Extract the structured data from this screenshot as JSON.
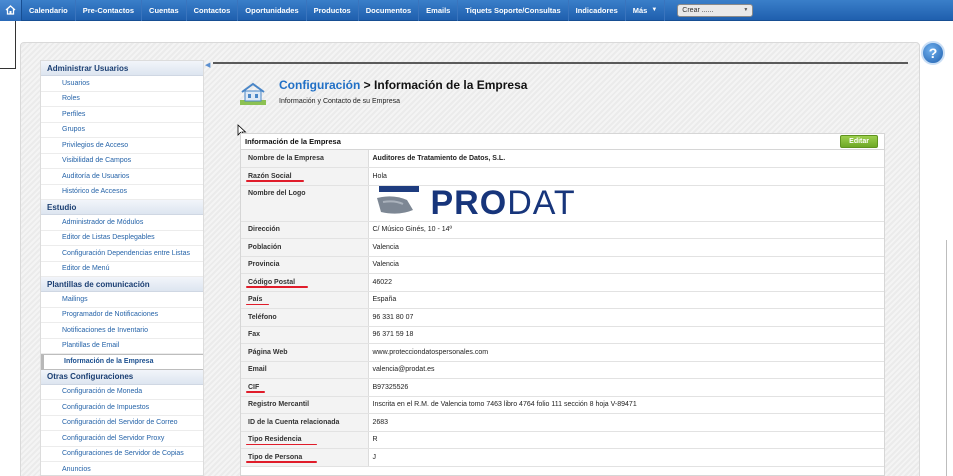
{
  "nav": {
    "items": [
      "Calendario",
      "Pre-Contactos",
      "Cuentas",
      "Contactos",
      "Oportunidades",
      "Productos",
      "Documentos",
      "Emails",
      "Tiquets Soporte/Consultas",
      "Indicadores"
    ],
    "more_label": "Más",
    "create_value": "Crear ......"
  },
  "sidebar": {
    "sections": [
      {
        "title": "Administrar Usuarios",
        "items": [
          "Usuarios",
          "Roles",
          "Perfiles",
          "Grupos",
          "Privilegios de Acceso",
          "Visibilidad de Campos",
          "Auditoría de Usuarios",
          "Histórico de Accesos"
        ]
      },
      {
        "title": "Estudio",
        "items": [
          "Administrador de Módulos",
          "Editor de Listas Desplegables",
          "Configuración Dependencias entre Listas",
          "Editor de Menú"
        ]
      },
      {
        "title": "Plantillas de comunicación",
        "items": [
          "Mailings",
          "Programador de Notificaciones",
          "Notificaciones de Inventario",
          "Plantillas de Email",
          "Información de la Empresa"
        ]
      },
      {
        "title": "Otras Configuraciones",
        "items": [
          "Configuración de Moneda",
          "Configuración de Impuestos",
          "Configuración del Servidor de Correo",
          "Configuración del Servidor Proxy",
          "Configuraciones de Servidor de Copias",
          "Anuncios"
        ]
      }
    ],
    "active_item": "Información de la Empresa"
  },
  "header": {
    "breadcrumb_link": "Configuración",
    "breadcrumb_sep": ">",
    "title": "Información de la Empresa",
    "subtitle": "Información y Contacto de su Empresa"
  },
  "panel": {
    "title": "Información de la Empresa",
    "edit_label": "Editar",
    "logo_text_bold": "PRO",
    "logo_text_light": "DAT",
    "rows": [
      {
        "label": "Nombre de la Empresa",
        "value": "Auditores de Tratamiento de Datos, S.L.",
        "bold": true,
        "marked": false
      },
      {
        "label": "Razón Social",
        "value": "Hola",
        "marked": true
      },
      {
        "label": "Nombre del Logo",
        "value": "",
        "logo": true,
        "marked": false
      },
      {
        "label": "Dirección",
        "value": "C/ Músico Ginés, 10 - 14º",
        "marked": false
      },
      {
        "label": "Población",
        "value": "Valencia",
        "marked": false
      },
      {
        "label": "Provincia",
        "value": "Valencia",
        "marked": false
      },
      {
        "label": "Código Postal",
        "value": "46022",
        "marked": true
      },
      {
        "label": "País",
        "value": "España",
        "marked": true
      },
      {
        "label": "Teléfono",
        "value": "96 331 80 07",
        "marked": false
      },
      {
        "label": "Fax",
        "value": "96 371 59 18",
        "marked": false
      },
      {
        "label": "Página Web",
        "value": "www.proteccion­datospersonales.com",
        "marked": false
      },
      {
        "label": "Email",
        "value": "valencia@prodat.es",
        "marked": false
      },
      {
        "label": "CIF",
        "value": "B97325526",
        "marked": true
      },
      {
        "label": "Registro Mercantil",
        "value": "Inscrita en el R.M. de Valencia tomo 7463 libro 4764 folio 111 sección 8 hoja V-89471",
        "marked": false
      },
      {
        "label": "ID de la Cuenta relacionada",
        "value": "2683",
        "marked": false
      },
      {
        "label": "Tipo Residencia",
        "value": "R",
        "marked": true
      },
      {
        "label": "Tipo de Persona",
        "value": "J",
        "marked": true
      }
    ]
  },
  "colors": {
    "nav_bg": "#2a69b7",
    "link": "#2170c6",
    "edit_btn": "#7db533",
    "mark": "#e01c2a"
  }
}
